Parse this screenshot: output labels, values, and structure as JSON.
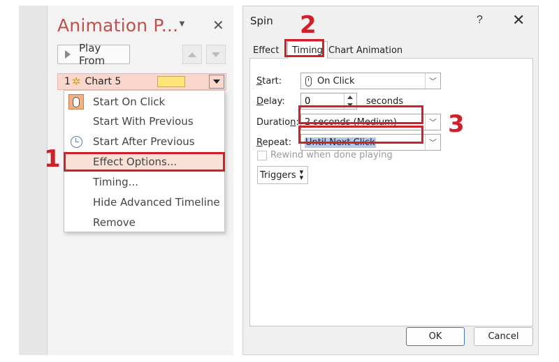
{
  "animation_pane": {
    "title": "Animation P...",
    "play_from_label": "Play From",
    "chart_item": {
      "number": "1",
      "name": "Chart 5",
      "swatch_color": "#ffe47a"
    },
    "menu_items": [
      {
        "label": "Start On Click",
        "icon": "mouse-icon"
      },
      {
        "label": "Start With Previous",
        "icon": ""
      },
      {
        "label": "Start After Previous",
        "icon": "clock-icon"
      },
      {
        "label": "Effect Options...",
        "icon": ""
      },
      {
        "label": "Timing...",
        "icon": ""
      },
      {
        "label": "Hide Advanced Timeline",
        "icon": ""
      },
      {
        "label": "Remove",
        "icon": ""
      }
    ]
  },
  "dialog": {
    "title": "Spin",
    "help": "?",
    "close": "✕",
    "tabs": [
      "Effect",
      "Timing",
      "Chart Animation"
    ],
    "active_tab": "Timing",
    "fields": {
      "start_label": "Start:",
      "start_value": "On Click",
      "delay_label": "Delay:",
      "delay_value": "0",
      "delay_unit": "seconds",
      "duration_label": "Duration:",
      "duration_value": "2 seconds (Medium)",
      "repeat_label": "Repeat:",
      "repeat_value": "Until Next Click"
    },
    "rewind_label": "Rewind when done playing",
    "rewind_checked": false,
    "triggers_label": "Triggers",
    "ok_label": "OK",
    "cancel_label": "Cancel"
  },
  "annotations": {
    "step1": "1",
    "step2": "2",
    "step3": "3",
    "color": "#d0202a"
  }
}
